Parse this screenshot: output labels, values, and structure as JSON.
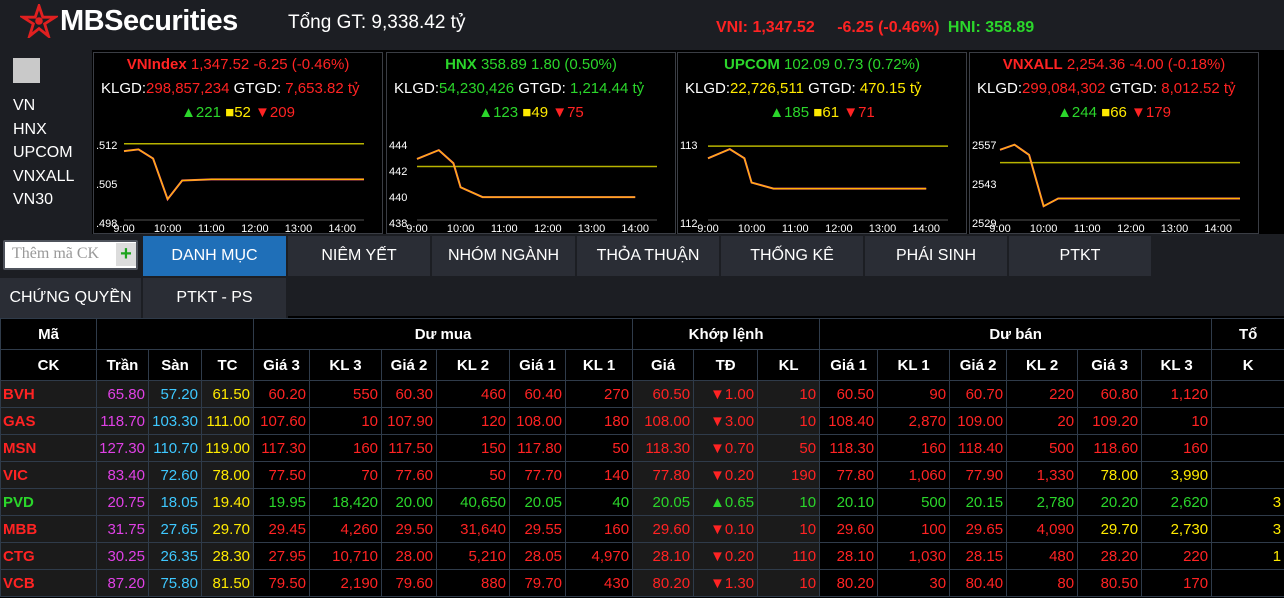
{
  "logo_text": "MBSecurities",
  "total": "Tổng GT: 9,338.42 tỷ",
  "quick": {
    "vni": "VNI: 1,347.52",
    "vni_change": "-6.25 (-0.46%)",
    "hni": "HNI: 358.89"
  },
  "index_list": [
    "VN",
    "HNX",
    "UPCOM",
    "VNXALL",
    "VN30"
  ],
  "panels": [
    {
      "name": "VNIndex",
      "value": "1,347.52",
      "change": "-6.25 (-0.46%)",
      "dir": "dn",
      "klgd_label": "KLGD:",
      "klgd": "298,857,234",
      "gtgd_label": "GTGD:",
      "gtgd": "7,653.82 tỷ",
      "val_color": "dn",
      "up": "221",
      "ref": "52",
      "down": "209",
      "y_labels": [
        ".512",
        ".505",
        ".498"
      ],
      "times": [
        "9:00",
        "10:00",
        "11:00",
        "12:00",
        "13:00",
        "14:00"
      ],
      "chart_data": {
        "type": "line",
        "x": [
          "9:00",
          "9:20",
          "9:40",
          "10:00",
          "10:20",
          "11:00",
          "12:00",
          "13:00",
          "14:00",
          "14:30"
        ],
        "y": [
          1352.5,
          1352.8,
          1351.2,
          1344.0,
          1347.3,
          1347.5,
          1347.5,
          1347.5,
          1347.5,
          1347.5
        ],
        "ref": 1353.8,
        "ylim": [
          1340.5,
          1355.0
        ]
      }
    },
    {
      "name": "HNX",
      "value": "358.89",
      "change": "1.80 (0.50%)",
      "dir": "up",
      "klgd_label": "KLGD:",
      "klgd": "54,230,426",
      "gtgd_label": "GTGD:",
      "gtgd": "1,214.44 tỷ",
      "val_color": "up",
      "up": "123",
      "ref": "49",
      "down": "75",
      "y_labels": [
        "444",
        "442",
        "440",
        "438"
      ],
      "times": [
        "9:00",
        "10:00",
        "11:00",
        "12:00",
        "13:00",
        "14:00"
      ],
      "chart_data": {
        "type": "line",
        "x": [
          "9:00",
          "9:30",
          "9:50",
          "10:00",
          "10:30",
          "11:00",
          "12:00",
          "13:00",
          "14:00"
        ],
        "y": [
          443.0,
          443.8,
          442.6,
          440.4,
          439.5,
          439.5,
          439.5,
          439.5,
          439.5
        ],
        "ref": 442.3,
        "ylim": [
          437.5,
          445.0
        ]
      }
    },
    {
      "name": "UPCOM",
      "value": "102.09",
      "change": "0.73 (0.72%)",
      "dir": "up",
      "klgd_label": "KLGD:",
      "klgd": "22,726,511",
      "gtgd_label": "GTGD:",
      "gtgd": "470.15 tỷ",
      "val_color": "ref",
      "up": "185",
      "ref": "61",
      "down": "71",
      "y_labels": [
        "113",
        "112"
      ],
      "times": [
        "9:00",
        "10:00",
        "11:00",
        "12:00",
        "13:00",
        "14:00"
      ],
      "chart_data": {
        "type": "line",
        "x": [
          "9:00",
          "9:30",
          "9:50",
          "10:00",
          "10:30",
          "11:00",
          "12:00",
          "13:00",
          "14:00"
        ],
        "y": [
          113.9,
          114.2,
          113.9,
          113.1,
          112.9,
          112.9,
          112.9,
          112.9,
          112.9
        ],
        "ref": 114.3,
        "ylim": [
          111.9,
          114.6
        ]
      }
    },
    {
      "name": "VNXALL",
      "value": "2,254.36",
      "change": "-4.00 (-0.18%)",
      "dir": "dn",
      "klgd_label": "KLGD:",
      "klgd": "299,084,302",
      "gtgd_label": "GTGD:",
      "gtgd": "8,012.52 tỷ",
      "val_color": "dn",
      "up": "244",
      "ref": "66",
      "down": "179",
      "y_labels": [
        "2557",
        "2543",
        "2529"
      ],
      "times": [
        "9:00",
        "10:00",
        "11:00",
        "12:00",
        "13:00",
        "14:00"
      ],
      "chart_data": {
        "type": "line",
        "x": [
          "9:00",
          "9:20",
          "9:40",
          "10:00",
          "10:20",
          "11:00",
          "12:00",
          "13:00",
          "14:00",
          "14:30"
        ],
        "y": [
          2555.0,
          2557.0,
          2553.0,
          2533.0,
          2536.0,
          2536.0,
          2536.0,
          2536.0,
          2536.0,
          2536.0
        ],
        "ref": 2550.0,
        "ylim": [
          2528.0,
          2560.0
        ]
      }
    }
  ],
  "add_placeholder": "Thêm mã CK",
  "add_button": "+",
  "tabs": [
    "DANH MỤC",
    "NIÊM YẾT",
    "NHÓM NGÀNH",
    "THỎA THUẬN",
    "THỐNG KÊ",
    "PHÁI SINH",
    "PTKT",
    "CHỨNG QUYỀN",
    "PTKT - PS"
  ],
  "table": {
    "head_top": {
      "ma": "Mã",
      "du_mua": "Dư mua",
      "khop": "Khớp lệnh",
      "du_ban": "Dư bán",
      "extra": "Tổ"
    },
    "head_bottom": {
      "ck": "CK",
      "tran": "Trần",
      "san": "Sàn",
      "tc": "TC",
      "mua": [
        "Giá 3",
        "KL 3",
        "Giá 2",
        "KL 2",
        "Giá 1",
        "KL 1"
      ],
      "khop": [
        "Giá",
        "TĐ",
        "KL"
      ],
      "ban": [
        "Giá 1",
        "KL 1",
        "Giá 2",
        "KL 2",
        "Giá 3",
        "KL 3"
      ],
      "extra": "K"
    },
    "rows": [
      {
        "sym": "BVH",
        "c": "dn",
        "tran": "65.80",
        "san": "57.20",
        "tc": "61.50",
        "v": [
          "60.20",
          "550",
          "60.30",
          "460",
          "60.40",
          "270",
          "60.50",
          "▼1.00",
          "10",
          "60.50",
          "90",
          "60.70",
          "220",
          "60.80",
          "1,120"
        ],
        "vc": [
          "dn",
          "dn",
          "dn",
          "dn",
          "dn",
          "dn",
          "dn",
          "dn",
          "dn",
          "dn",
          "dn",
          "dn",
          "dn",
          "dn",
          "dn"
        ],
        "extra": ""
      },
      {
        "sym": "GAS",
        "c": "dn",
        "tran": "118.70",
        "san": "103.30",
        "tc": "111.00",
        "v": [
          "107.60",
          "10",
          "107.90",
          "120",
          "108.00",
          "180",
          "108.00",
          "▼3.00",
          "10",
          "108.40",
          "2,870",
          "109.00",
          "20",
          "109.20",
          "10"
        ],
        "vc": [
          "dn",
          "dn",
          "dn",
          "dn",
          "dn",
          "dn",
          "dn",
          "dn",
          "dn",
          "dn",
          "dn",
          "dn",
          "dn",
          "dn",
          "dn"
        ],
        "extra": ""
      },
      {
        "sym": "MSN",
        "c": "dn",
        "tran": "127.30",
        "san": "110.70",
        "tc": "119.00",
        "v": [
          "117.30",
          "160",
          "117.50",
          "150",
          "117.80",
          "50",
          "118.30",
          "▼0.70",
          "50",
          "118.30",
          "160",
          "118.40",
          "500",
          "118.60",
          "160"
        ],
        "vc": [
          "dn",
          "dn",
          "dn",
          "dn",
          "dn",
          "dn",
          "dn",
          "dn",
          "dn",
          "dn",
          "dn",
          "dn",
          "dn",
          "dn",
          "dn"
        ],
        "extra": ""
      },
      {
        "sym": "VIC",
        "c": "dn",
        "tran": "83.40",
        "san": "72.60",
        "tc": "78.00",
        "v": [
          "77.50",
          "70",
          "77.60",
          "50",
          "77.70",
          "140",
          "77.80",
          "▼0.20",
          "190",
          "77.80",
          "1,060",
          "77.90",
          "1,330",
          "78.00",
          "3,990"
        ],
        "vc": [
          "dn",
          "dn",
          "dn",
          "dn",
          "dn",
          "dn",
          "dn",
          "dn",
          "dn",
          "dn",
          "dn",
          "dn",
          "dn",
          "eq",
          "eq"
        ],
        "extra": ""
      },
      {
        "sym": "PVD",
        "c": "up",
        "tran": "20.75",
        "san": "18.05",
        "tc": "19.40",
        "v": [
          "19.95",
          "18,420",
          "20.00",
          "40,650",
          "20.05",
          "40",
          "20.05",
          "▲0.65",
          "10",
          "20.10",
          "500",
          "20.15",
          "2,780",
          "20.20",
          "2,620"
        ],
        "vc": [
          "up",
          "up",
          "up",
          "up",
          "up",
          "up",
          "up",
          "up",
          "up",
          "up",
          "up",
          "up",
          "up",
          "up",
          "up"
        ],
        "extra": "3"
      },
      {
        "sym": "MBB",
        "c": "dn",
        "tran": "31.75",
        "san": "27.65",
        "tc": "29.70",
        "v": [
          "29.45",
          "4,260",
          "29.50",
          "31,640",
          "29.55",
          "160",
          "29.60",
          "▼0.10",
          "10",
          "29.60",
          "100",
          "29.65",
          "4,090",
          "29.70",
          "2,730"
        ],
        "vc": [
          "dn",
          "dn",
          "dn",
          "dn",
          "dn",
          "dn",
          "dn",
          "dn",
          "dn",
          "dn",
          "dn",
          "dn",
          "dn",
          "eq",
          "eq"
        ],
        "extra": "3"
      },
      {
        "sym": "CTG",
        "c": "dn",
        "tran": "30.25",
        "san": "26.35",
        "tc": "28.30",
        "v": [
          "27.95",
          "10,710",
          "28.00",
          "5,210",
          "28.05",
          "4,970",
          "28.10",
          "▼0.20",
          "110",
          "28.10",
          "1,030",
          "28.15",
          "480",
          "28.20",
          "220"
        ],
        "vc": [
          "dn",
          "dn",
          "dn",
          "dn",
          "dn",
          "dn",
          "dn",
          "dn",
          "dn",
          "dn",
          "dn",
          "dn",
          "dn",
          "dn",
          "dn"
        ],
        "extra": "1"
      },
      {
        "sym": "VCB",
        "c": "dn",
        "tran": "87.20",
        "san": "75.80",
        "tc": "81.50",
        "v": [
          "79.50",
          "2,190",
          "79.60",
          "880",
          "79.70",
          "430",
          "80.20",
          "▼1.30",
          "10",
          "80.20",
          "30",
          "80.40",
          "80",
          "80.50",
          "170"
        ],
        "vc": [
          "dn",
          "dn",
          "dn",
          "dn",
          "dn",
          "dn",
          "dn",
          "dn",
          "dn",
          "dn",
          "dn",
          "dn",
          "dn",
          "dn",
          "dn"
        ],
        "extra": ""
      }
    ]
  },
  "colors": {
    "up": "#2bd62b",
    "down": "#ff2323",
    "ref": "#ffea00",
    "ceiling": "#e041e6",
    "floor": "#3ec8ff",
    "accent": "#1f6fb8"
  },
  "icons": {
    "logo": "mb-star-icon",
    "add": "plus-icon"
  }
}
